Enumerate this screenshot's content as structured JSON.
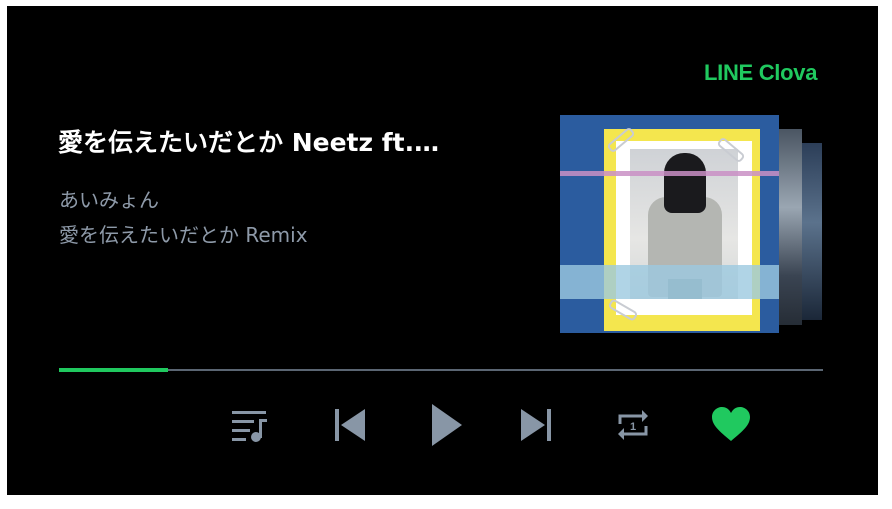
{
  "brand": "LINE Clova",
  "track": {
    "title": "愛を伝えたいだとか Neetz ft.…",
    "artist": "あいみょん",
    "album": "愛を伝えたいだとか Remix"
  },
  "progress": {
    "fraction": 0.143
  },
  "controls": {
    "playlist": "playlist-icon",
    "previous": "skip-previous-icon",
    "play": "play-icon",
    "next": "skip-next-icon",
    "repeat": "repeat-one-icon",
    "repeat_badge": "1",
    "like": "heart-icon"
  },
  "colors": {
    "accent": "#20c95f",
    "control": "#8896a6",
    "background": "#000000"
  }
}
